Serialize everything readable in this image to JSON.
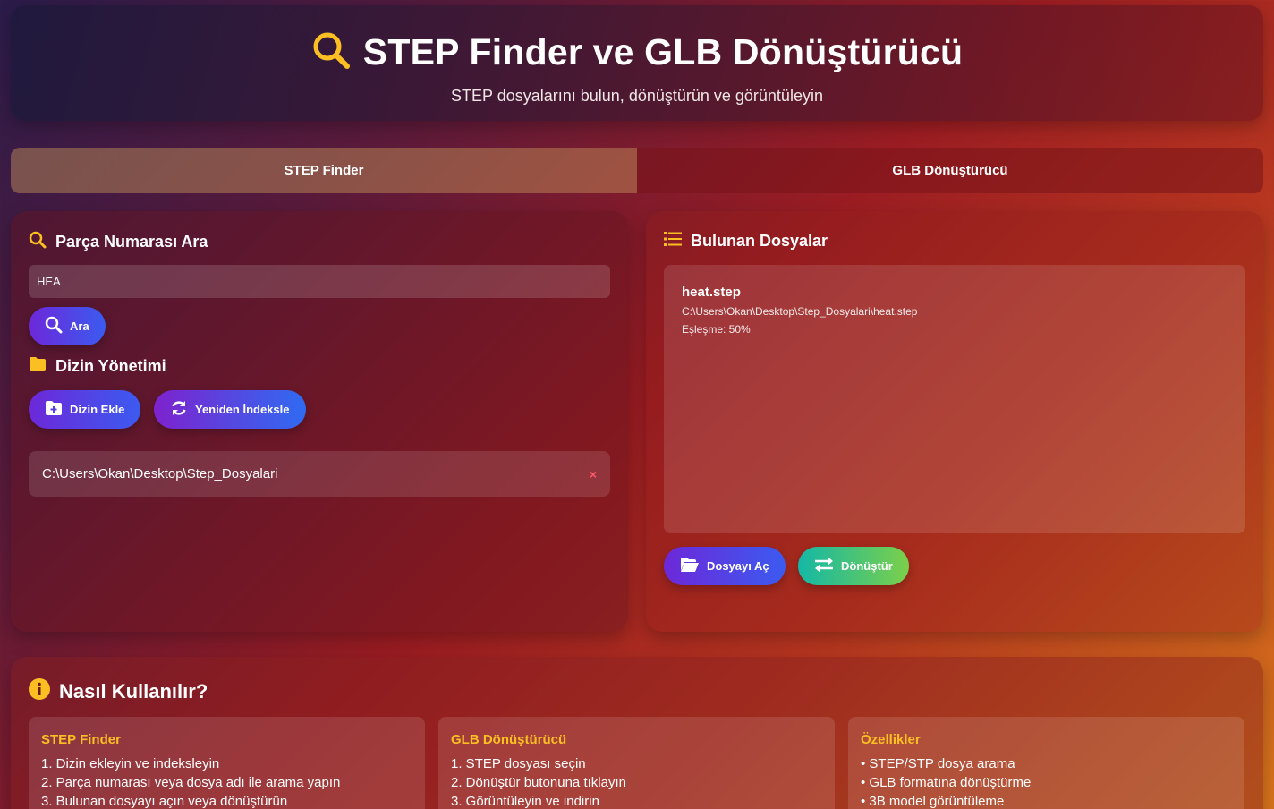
{
  "header": {
    "title": "STEP Finder ve GLB Dönüştürücü",
    "subtitle": "STEP dosyalarını bulun, dönüştürün ve görüntüleyin"
  },
  "tabs": [
    {
      "label": "STEP Finder",
      "active": true
    },
    {
      "label": "GLB Dönüştürücü",
      "active": false
    }
  ],
  "search": {
    "title": "Parça Numarası Ara",
    "value": "HEA",
    "button": "Ara"
  },
  "directories": {
    "title": "Dizin Yönetimi",
    "add_button": "Dizin Ekle",
    "reindex_button": "Yeniden İndeksle",
    "items": [
      {
        "path": "C:\\Users\\Okan\\Desktop\\Step_Dosyalari",
        "remove": "×"
      }
    ]
  },
  "results": {
    "title": "Bulunan Dosyalar",
    "items": [
      {
        "name": "heat.step",
        "path": "C:\\Users\\Okan\\Desktop\\Step_Dosyalari\\heat.step",
        "match": "Eşleşme: 50%"
      }
    ],
    "open_button": "Dosyayı Aç",
    "convert_button": "Dönüştür"
  },
  "howto": {
    "title": "Nasıl Kullanılır?",
    "cards": [
      {
        "title": "STEP Finder",
        "lines": [
          "1. Dizin ekleyin ve indeksleyin",
          "2. Parça numarası veya dosya adı ile arama yapın",
          "3. Bulunan dosyayı açın veya dönüştürün"
        ]
      },
      {
        "title": "GLB Dönüştürücü",
        "lines": [
          "1. STEP dosyası seçin",
          "2. Dönüştür butonuna tıklayın",
          "3. Görüntüleyin ve indirin"
        ]
      },
      {
        "title": "Özellikler",
        "lines": [
          "• STEP/STP dosya arama",
          "• GLB formatına dönüştürme",
          "• 3B model görüntüleme"
        ]
      }
    ]
  },
  "colors": {
    "accent_yellow": "#fbbf24",
    "remove_red": "#ff5a6a"
  }
}
